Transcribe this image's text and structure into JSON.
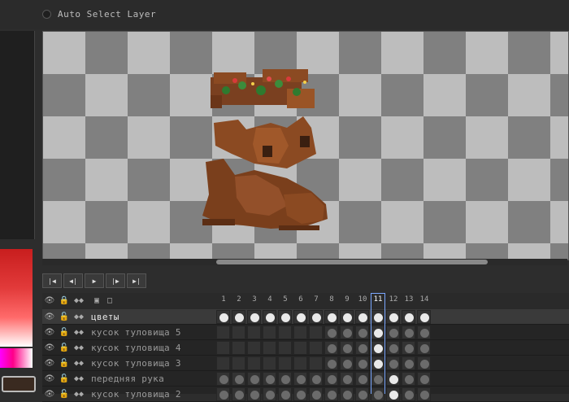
{
  "toolbar": {
    "auto_select_label": "Auto Select Layer"
  },
  "playback": {
    "buttons": [
      {
        "name": "first-frame-button",
        "glyph": "|◀"
      },
      {
        "name": "prev-frame-button",
        "glyph": "◀|"
      },
      {
        "name": "play-button",
        "glyph": "▶"
      },
      {
        "name": "next-frame-button",
        "glyph": "|▶"
      },
      {
        "name": "last-frame-button",
        "glyph": "▶|"
      }
    ]
  },
  "timeline": {
    "frames": [
      "1",
      "2",
      "3",
      "4",
      "5",
      "6",
      "7",
      "8",
      "9",
      "10",
      "11",
      "12",
      "13",
      "14"
    ],
    "current_frame": "11",
    "layers": [
      {
        "name": "цветы",
        "active": true,
        "cels": "wwwwwwwwwwwwww"
      },
      {
        "name": "кусок туловища 5",
        "active": false,
        "cels": "-------gggwggg"
      },
      {
        "name": "кусок туловища 4",
        "active": false,
        "cels": "-------gggwggg"
      },
      {
        "name": "кусок туловища 3",
        "active": false,
        "cels": "-------gggwggg"
      },
      {
        "name": "передняя рука",
        "active": false,
        "cels": "gggggggggggwggg"
      },
      {
        "name": "кусок туловища 2",
        "active": false,
        "cels": "gggggggggggwggg"
      }
    ]
  },
  "colors": {
    "accent": "#7aa7ff",
    "primary_color": "#c81e1e",
    "secondary_color": "#3a2a20"
  }
}
